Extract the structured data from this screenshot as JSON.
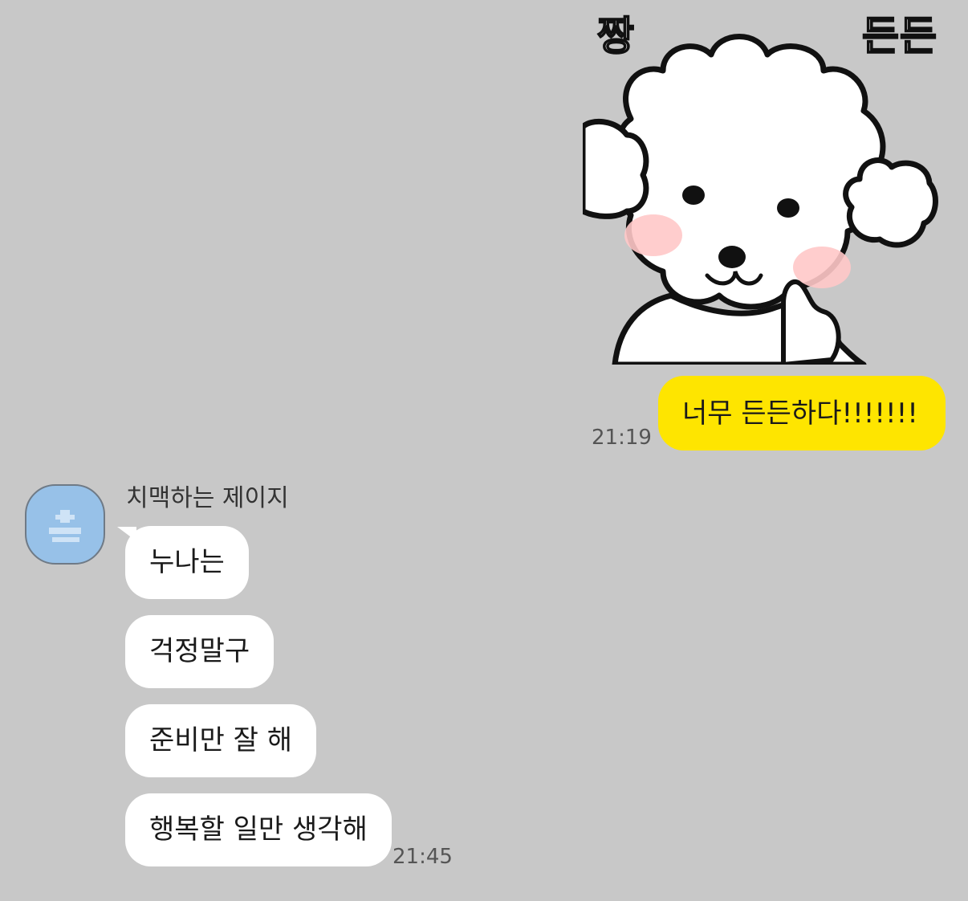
{
  "sticker": {
    "word_left": "짱",
    "word_right": "든든"
  },
  "outgoing": {
    "text": "너무 든든하다!!!!!!!",
    "time": "21:19",
    "bubble_color": "#fee500"
  },
  "incoming": {
    "sender": "치맥하는 제이지",
    "messages": [
      {
        "text": "누나는"
      },
      {
        "text": "걱정말구"
      },
      {
        "text": "준비만 잘 해"
      },
      {
        "text": "행복할 일만 생각해"
      }
    ],
    "time": "21:45",
    "bubble_color": "#ffffff"
  },
  "avatar": {
    "icon": "default-profile-icon",
    "color": "#97c1e8"
  },
  "background_color": "#c8c8c8"
}
